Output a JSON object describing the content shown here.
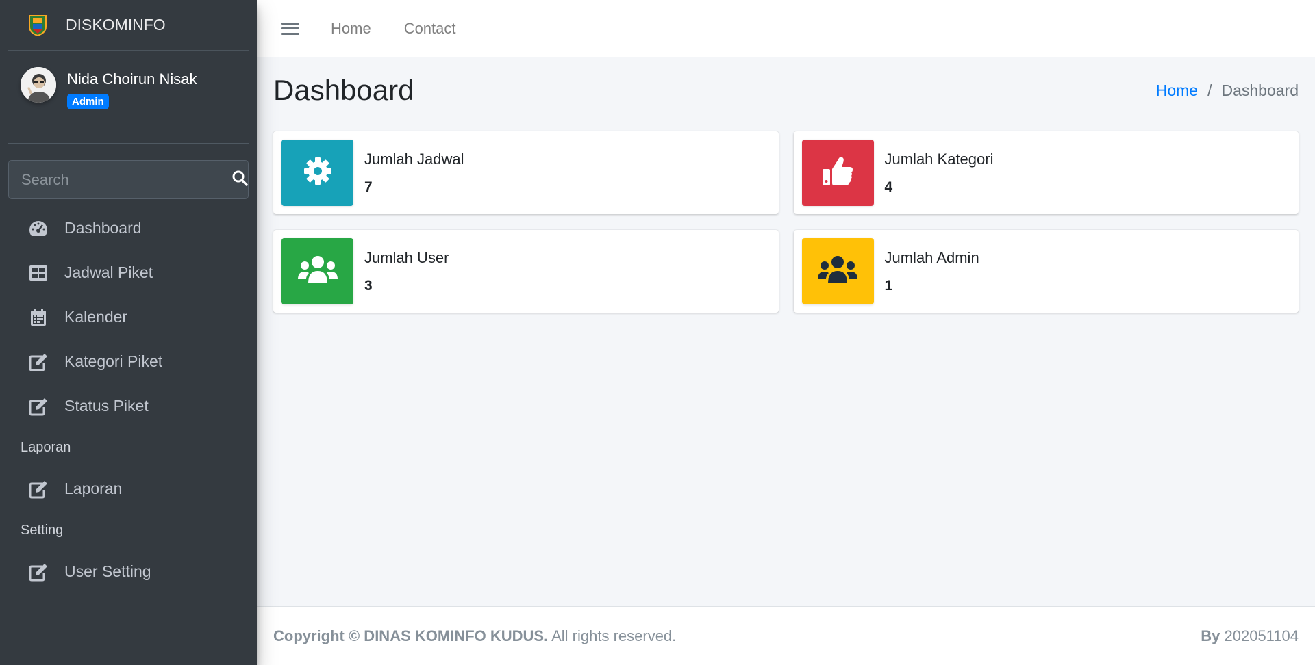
{
  "brand": {
    "name": "DISKOMINFO"
  },
  "user": {
    "name": "Nida Choirun Nisak",
    "role": "Admin"
  },
  "search": {
    "placeholder": "Search"
  },
  "sidebar": {
    "items": [
      {
        "label": "Dashboard",
        "icon": "tachometer-icon"
      },
      {
        "label": "Jadwal Piket",
        "icon": "table-icon"
      },
      {
        "label": "Kalender",
        "icon": "calendar-icon"
      },
      {
        "label": "Kategori Piket",
        "icon": "edit-icon"
      },
      {
        "label": "Status Piket",
        "icon": "edit-icon"
      }
    ],
    "section_laporan": "Laporan",
    "laporan_items": [
      {
        "label": "Laporan",
        "icon": "edit-icon"
      }
    ],
    "section_setting": "Setting",
    "setting_items": [
      {
        "label": "User Setting",
        "icon": "edit-icon"
      }
    ]
  },
  "navbar": {
    "links": [
      "Home",
      "Contact"
    ]
  },
  "content": {
    "title": "Dashboard",
    "breadcrumb": {
      "home": "Home",
      "current": "Dashboard"
    },
    "boxes": [
      {
        "label": "Jumlah Jadwal",
        "value": "7",
        "color": "#17a2b8",
        "icon": "gear-icon"
      },
      {
        "label": "Jumlah Kategori",
        "value": "4",
        "color": "#dc3545",
        "icon": "thumbs-up-icon"
      },
      {
        "label": "Jumlah User",
        "value": "3",
        "color": "#28a745",
        "icon": "users-icon"
      },
      {
        "label": "Jumlah Admin",
        "value": "1",
        "color": "#ffc107",
        "icon": "users-icon"
      }
    ]
  },
  "footer": {
    "copyright_prefix": "Copyright © DINAS KOMINFO KUDUS.",
    "copyright_suffix": " All rights reserved.",
    "by_label": "By",
    "by_value": " 202051104"
  }
}
